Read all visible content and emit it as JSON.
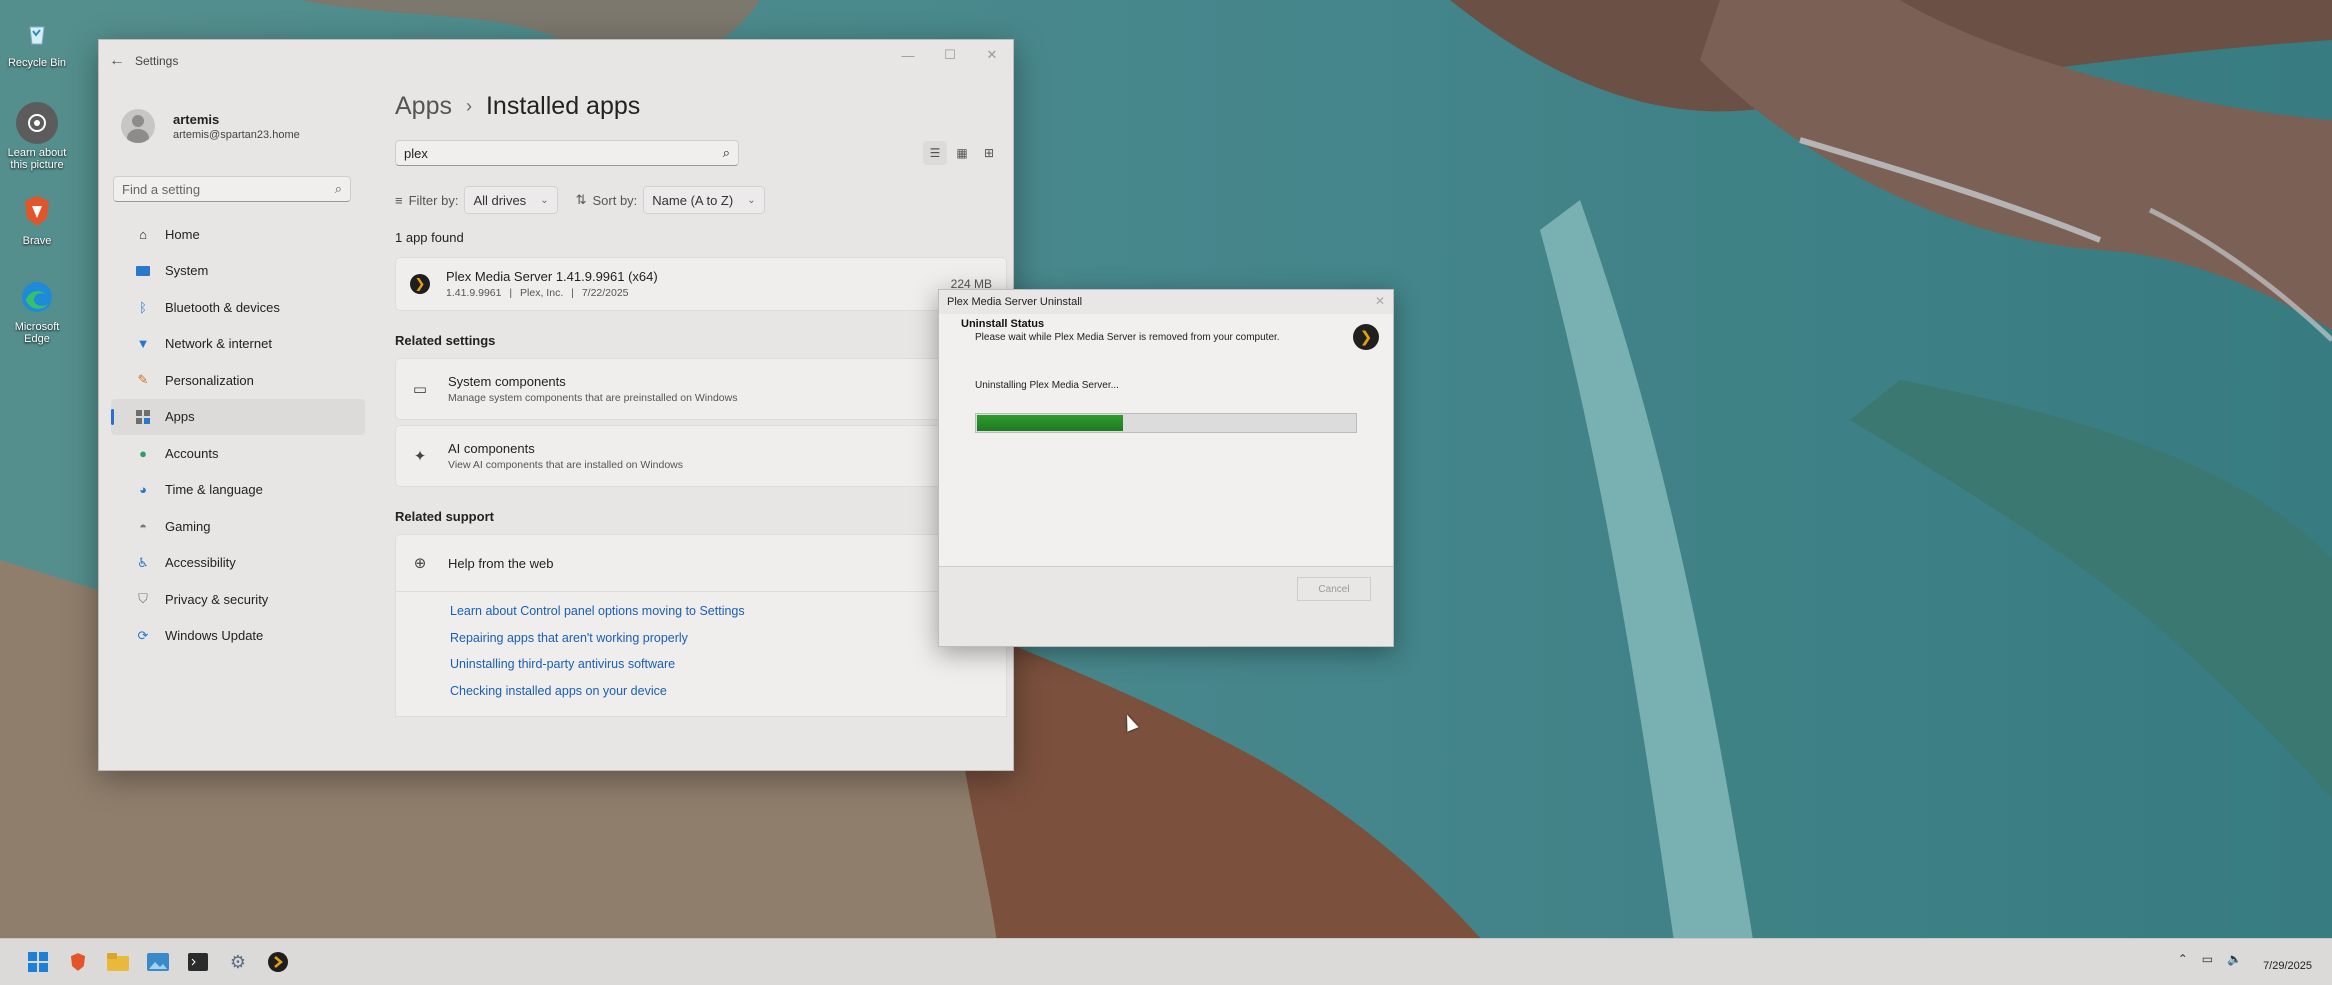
{
  "desktop": {
    "icons": [
      {
        "label": "Recycle Bin",
        "icon": "recycle-bin-icon"
      },
      {
        "label": "Learn about this picture",
        "icon": "camera-icon"
      },
      {
        "label": "Brave",
        "icon": "brave-icon"
      },
      {
        "label": "Microsoft Edge",
        "icon": "edge-icon"
      }
    ]
  },
  "settings": {
    "title": "Settings",
    "user": {
      "name": "artemis",
      "email": "artemis@spartan23.home"
    },
    "find_placeholder": "Find a setting",
    "nav": [
      {
        "label": "Home",
        "icon": "home-icon"
      },
      {
        "label": "System",
        "icon": "system-icon"
      },
      {
        "label": "Bluetooth & devices",
        "icon": "bluetooth-icon"
      },
      {
        "label": "Network & internet",
        "icon": "wifi-icon"
      },
      {
        "label": "Personalization",
        "icon": "brush-icon"
      },
      {
        "label": "Apps",
        "icon": "apps-icon",
        "active": true
      },
      {
        "label": "Accounts",
        "icon": "accounts-icon"
      },
      {
        "label": "Time & language",
        "icon": "globe-clock-icon"
      },
      {
        "label": "Gaming",
        "icon": "gamepad-icon"
      },
      {
        "label": "Accessibility",
        "icon": "accessibility-icon"
      },
      {
        "label": "Privacy & security",
        "icon": "shield-icon"
      },
      {
        "label": "Windows Update",
        "icon": "update-icon"
      }
    ],
    "breadcrumb": {
      "parent": "Apps",
      "current": "Installed apps"
    },
    "search_value": "plex",
    "filter_label": "Filter by:",
    "filter_value": "All drives",
    "sort_label": "Sort by:",
    "sort_value": "Name (A to Z)",
    "app_count": "1 app found",
    "apps": [
      {
        "name": "Plex Media Server 1.41.9.9961 (x64)",
        "version": "1.41.9.9961",
        "publisher": "Plex, Inc.",
        "date": "7/22/2025",
        "size": "224 MB"
      }
    ],
    "related_settings_title": "Related settings",
    "related_settings": [
      {
        "title": "System components",
        "subtitle": "Manage system components that are preinstalled on Windows",
        "icon": "components-icon"
      },
      {
        "title": "AI components",
        "subtitle": "View AI components that are installed on Windows",
        "icon": "sparkle-icon"
      }
    ],
    "related_support_title": "Related support",
    "help_title": "Help from the web",
    "help_links": [
      "Learn about Control panel options moving to Settings",
      "Repairing apps that aren't working properly",
      "Uninstalling third-party antivirus software",
      "Checking installed apps on your device"
    ]
  },
  "uninstall_dialog": {
    "title": "Plex Media Server Uninstall",
    "heading": "Uninstall Status",
    "subheading": "Please wait while Plex Media Server is removed from your computer.",
    "status": "Uninstalling Plex Media Server...",
    "progress": 0.39,
    "cancel_label": "Cancel"
  },
  "taskbar": {
    "apps": [
      "start-icon",
      "brave-icon",
      "file-explorer-icon",
      "photos-icon",
      "terminal-icon",
      "settings-gear-icon",
      "plex-icon"
    ],
    "date": "7/29/2025"
  },
  "colors": {
    "accent": "#2a6fd1",
    "link": "#1a5fb4",
    "progress": "#2f9c2f",
    "plex": "#e5a00d"
  }
}
